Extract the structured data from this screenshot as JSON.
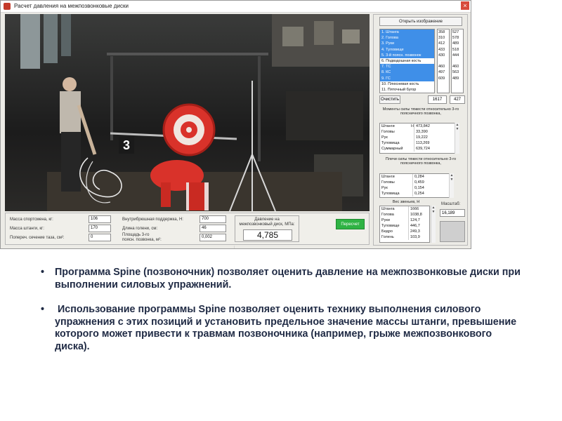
{
  "window": {
    "title": "Расчет давления на межпозвонковые диски",
    "close_glyph": "×"
  },
  "video": {
    "plate_number": "3"
  },
  "bottom": {
    "labels": {
      "athlete_mass": "Масса спортсмена, кг:",
      "barbell_mass": "Масса штанги, кг:",
      "pelvis_section": "Попереч. сечение таза, см²:",
      "abdominal_support": "Внутрибрюшная поддержка, Н:",
      "shin_length": "Длина голени, см:",
      "vertebra_area_line1": "Площадь 3-го",
      "vertebra_area_line2": "поясн. позвонка, м²:",
      "pressure_line1": "Давление на",
      "pressure_line2": "межпозвонковый диск, МПа:"
    },
    "values": {
      "athlete_mass": "106",
      "barbell_mass": "170",
      "pelvis_section": "0",
      "abdominal_support": "700",
      "shin_length": "46",
      "vertebra_area": "0,002",
      "pressure": "4,785"
    },
    "recalc_label": "Пересчет"
  },
  "right": {
    "open_image_label": "Открыть изображение",
    "segments": [
      {
        "label": "1. Штанга",
        "selected": true
      },
      {
        "label": "2. Голова",
        "selected": true
      },
      {
        "label": "3. Руки",
        "selected": true
      },
      {
        "label": "4. Туловище",
        "selected": true
      },
      {
        "label": "5. 3-й поясн. позвонок",
        "selected": true
      },
      {
        "label": "6. Подвздошная кость",
        "selected": false
      },
      {
        "label": "7. ТС",
        "selected": true
      },
      {
        "label": "8. КС",
        "selected": true
      },
      {
        "label": "9. ГС",
        "selected": true
      },
      {
        "label": "10. Плюсневая кость",
        "selected": false
      },
      {
        "label": "11. Пяточный бугор",
        "selected": false
      }
    ],
    "col1": [
      "358",
      "310",
      "412",
      "433",
      "430",
      "",
      "460",
      "497",
      "609",
      "",
      ""
    ],
    "col2": [
      "527",
      "578",
      "489",
      "518",
      "444",
      "",
      "460",
      "563",
      "489",
      "",
      ""
    ],
    "clear_label": "Очистить",
    "sum1": "1617",
    "sum2": "427",
    "moments": {
      "title": "Моменты силы тяжести относительно 3-го поясничного позвонка,",
      "rows": [
        {
          "k": "Штанги",
          "v": "473,842"
        },
        {
          "k": "Головы",
          "v": "33,390"
        },
        {
          "k": "Рук",
          "v": "19,222"
        },
        {
          "k": "Туловища",
          "v": "113,269"
        },
        {
          "k": "Суммарный",
          "v": "639,724"
        }
      ]
    },
    "arms": {
      "title": "Плечи силы тяжести относительно 3-го поясничного позвонка,",
      "rows": [
        {
          "k": "Штанги",
          "v": "0,284"
        },
        {
          "k": "Головы",
          "v": "0,459"
        },
        {
          "k": "Рук",
          "v": "0,154"
        },
        {
          "k": "Туловища",
          "v": "0,254"
        }
      ]
    },
    "weights": {
      "title": "Вес звеньев, Н",
      "rows": [
        {
          "k": "Штанга",
          "v": "1666"
        },
        {
          "k": "Голова",
          "v": "1038,8"
        },
        {
          "k": "Руки",
          "v": "124,7"
        },
        {
          "k": "Туловище",
          "v": "446,7"
        },
        {
          "k": "Бедро",
          "v": "249,3"
        },
        {
          "k": "Голень",
          "v": "103,9"
        }
      ]
    },
    "scale_label": "Масштаб:",
    "scale_value": "16,189",
    "moments_h_label": "Н"
  },
  "text": {
    "bullet_glyph": "•",
    "bullet1": "Программа Spine (позвоночник) позволяет оценить давление на межпозвонковые диски при выполнении силовых упражнений.",
    "bullet2": " Использование программы Spine позволяет оценить технику выполнения силового упражнения с этих позиций и установить предельное значение массы штанги, превышение которого может привести к травмам позвоночника (например, грыже межпозвонкового диска)."
  },
  "colors": {
    "selection": "#3f8fe8",
    "recalc_button": "#2fb344",
    "text_dark": "#1f2a44",
    "plate_red": "#d9322a"
  }
}
